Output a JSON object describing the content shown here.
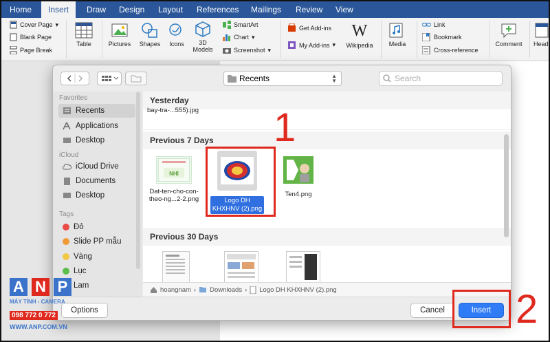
{
  "ribbon": {
    "tabs": [
      "Home",
      "Insert",
      "Draw",
      "Design",
      "Layout",
      "References",
      "Mailings",
      "Review",
      "View"
    ],
    "active_tab": "Insert",
    "pages": [
      "Cover Page",
      "Blank Page",
      "Page Break"
    ],
    "table": "Table",
    "pictures": "Pictures",
    "shapes": "Shapes",
    "icons": "Icons",
    "models": "3D Models",
    "smartart": "SmartArt",
    "chart": "Chart",
    "screenshot": "Screenshot",
    "getaddins": "Get Add-ins",
    "myaddins": "My Add-ins",
    "wikipedia": "Wikipedia",
    "media": "Media",
    "link": "Link",
    "bookmark": "Bookmark",
    "crossref": "Cross-reference",
    "comment": "Comment",
    "header_partial": "Head"
  },
  "dialog": {
    "location": "Recents",
    "search_placeholder": "Search",
    "sidebar": {
      "favorites_header": "Favorites",
      "favorites": [
        "Recents",
        "Applications",
        "Desktop"
      ],
      "icloud_header": "iCloud",
      "icloud": [
        "iCloud Drive",
        "Documents",
        "Desktop"
      ],
      "tags_header": "Tags",
      "tags": [
        {
          "label": "Đỏ",
          "color": "#ea4b47"
        },
        {
          "label": "Slide PP mẫu",
          "color": "#f09a37"
        },
        {
          "label": "Vàng",
          "color": "#f2c744"
        },
        {
          "label": "Lục",
          "color": "#5cbf4b"
        },
        {
          "label": "Lam",
          "color": "#3e8ef0"
        }
      ]
    },
    "sections": {
      "yesterday": "Yesterday",
      "previous7": "Previous 7 Days",
      "previous30": "Previous 30 Days"
    },
    "files": {
      "yesterday_file": "bay-tra-...555).jpg",
      "file1_line1": "Dat-ten-cho-con-",
      "file1_line2": "theo-ng...2-2.png",
      "file2_line1": "Logo DH",
      "file2_line2": "KHXHNV (2).png",
      "file3": "Ten4.png"
    },
    "path": [
      "hoangnam",
      "Downloads",
      "Logo DH KHXHNV (2).png"
    ],
    "options_button": "Options",
    "cancel_button": "Cancel",
    "insert_button": "Insert"
  },
  "annotations": {
    "step1": "1",
    "step2": "2"
  },
  "watermark": {
    "letters": [
      "A",
      "N",
      "P"
    ],
    "tagline": "MÁY TÍNH - CAMERA",
    "phone": "098 772 0 772",
    "site": "WWW.ANP.COM.VN"
  },
  "colors": {
    "ribbon_blue": "#2b579a",
    "accent_blue": "#2f7cf6",
    "annotation_red": "#e0291e"
  }
}
